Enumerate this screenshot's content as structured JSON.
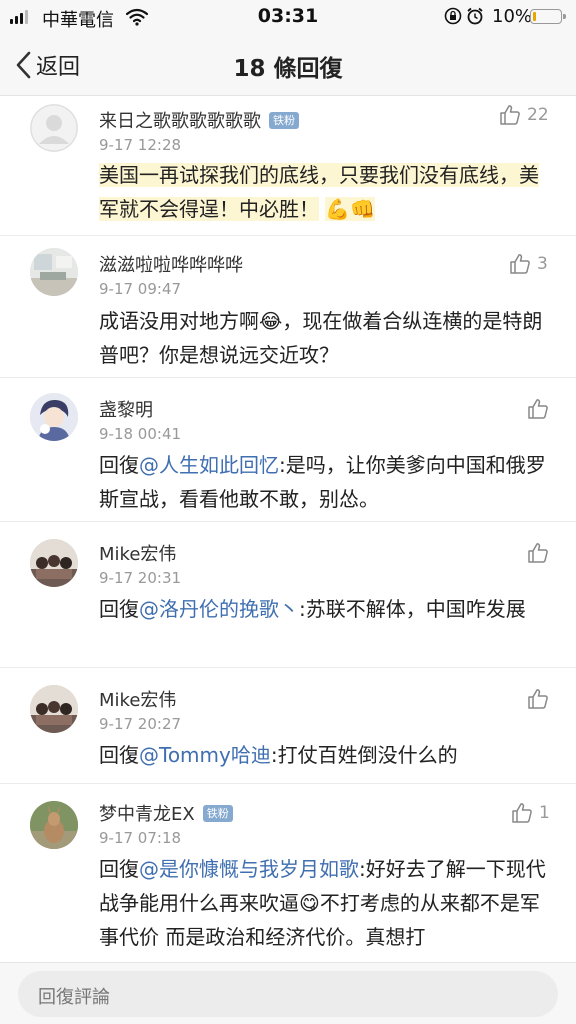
{
  "status_bar": {
    "carrier": "中華電信",
    "time": "03:31",
    "battery": "10%",
    "battery_level": 0.1
  },
  "nav": {
    "back_label": "返回",
    "title": "18 條回復"
  },
  "replies": [
    {
      "username": "来日之歌歌歌歌歌歌",
      "badge": "铁粉",
      "time": "9-17 12:28",
      "likes": "22",
      "text": "美国一再试探我们的底线，只要我们没有底线，美军就不会得逞！中必胜！",
      "emoji": [
        "💪",
        "👊"
      ]
    },
    {
      "username": "滋滋啦啦哗哗哗哗",
      "time": "9-17 09:47",
      "likes": "3",
      "text_a": "成语没用对地方啊",
      "emoji": "😂",
      "text_b": "，现在做着合纵连横的是特朗普吧？你是想说远交近攻？"
    },
    {
      "username": "盏黎明",
      "time": "9-18 00:41",
      "prefix": "回復",
      "mention": "@人生如此回忆",
      "text": ":是吗，让你美爹向中国和俄罗斯宣战，看看他敢不敢，别怂。"
    },
    {
      "username": "Mike宏伟",
      "time": "9-17 20:31",
      "prefix": "回復",
      "mention": "@洛丹伦的挽歌丶",
      "text": ":苏联不解体，中国咋发展"
    },
    {
      "username": "Mike宏伟",
      "time": "9-17 20:27",
      "prefix": "回復",
      "mention": "@Tommy哈迪",
      "text": ":打仗百姓倒没什么的"
    },
    {
      "username": "梦中青龙EX",
      "badge": "铁粉",
      "time": "9-17 07:18",
      "likes": "1",
      "prefix": "回復",
      "mention": "@是你慷慨与我岁月如歌",
      "text_a": ":好好去了解一下现代战争能用什么再来吹逼",
      "emoji": "😋",
      "text_b": "不打考虑的从来都不是军事代价 而是政治和经济代价。真想打"
    }
  ],
  "bottom_bar": {
    "placeholder": "回復評論"
  },
  "colors": {
    "mention": "#3f6fb0",
    "badge": "#86a9cf",
    "highlight": "#fdf6d3",
    "battery_low": "#e8a500"
  }
}
